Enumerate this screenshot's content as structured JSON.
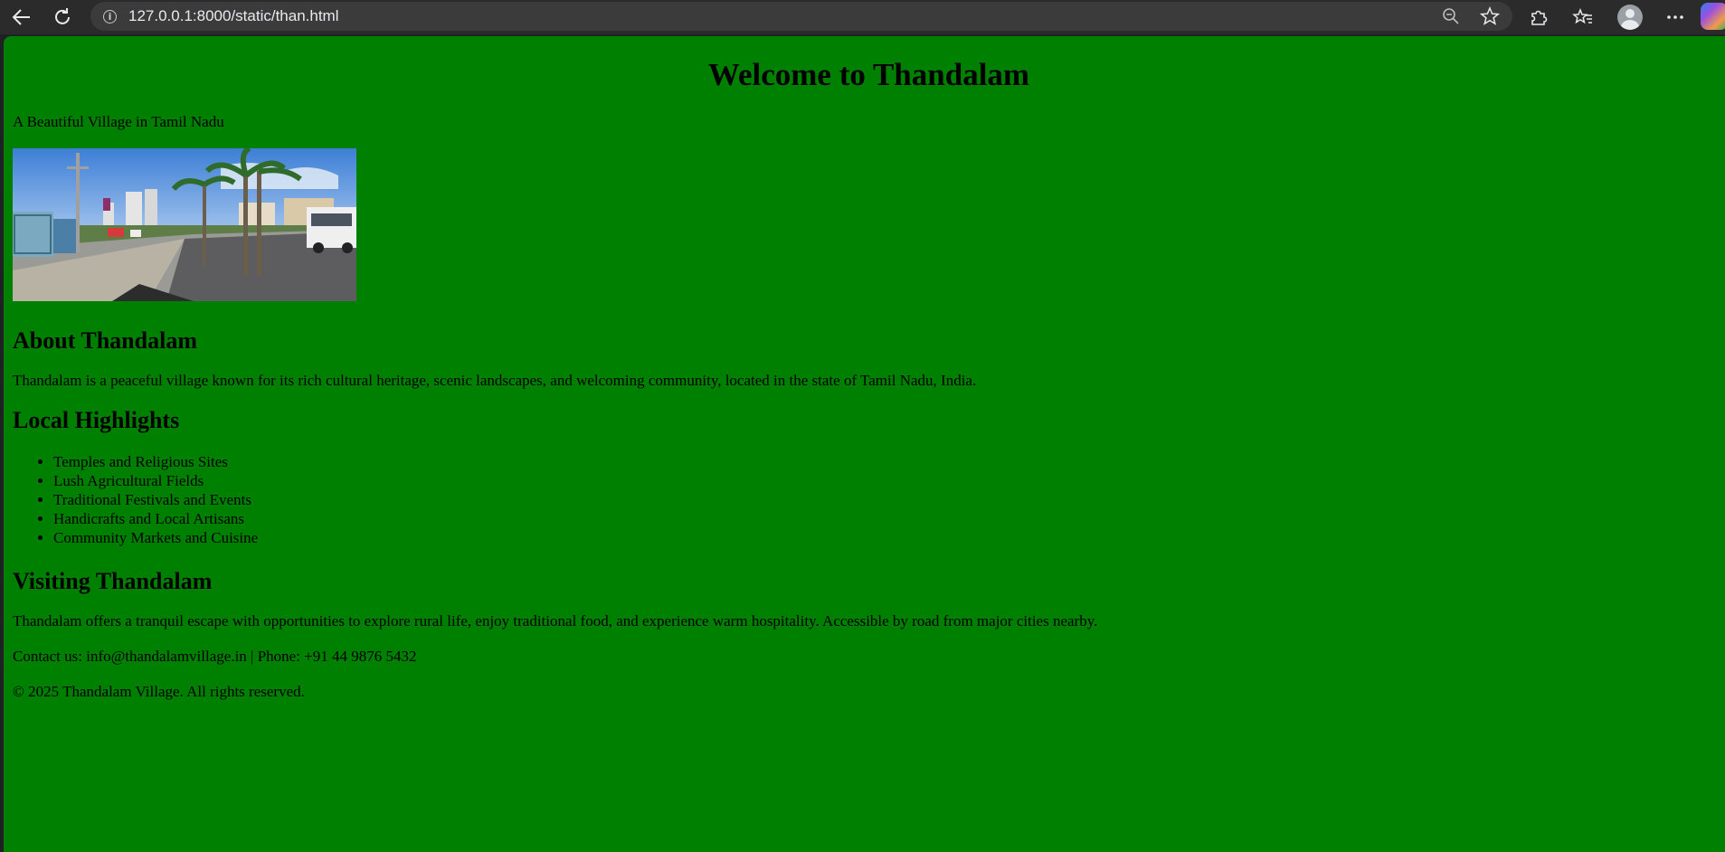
{
  "browser": {
    "url": "127.0.0.1:8000/static/than.html"
  },
  "page": {
    "title": "Welcome to Thandalam",
    "tagline": "A Beautiful Village in Tamil Nadu",
    "about": {
      "heading": "About Thandalam",
      "text": "Thandalam is a peaceful village known for its rich cultural heritage, scenic landscapes, and welcoming community, located in the state of Tamil Nadu, India."
    },
    "highlights": {
      "heading": "Local Highlights",
      "items": [
        "Temples and Religious Sites",
        "Lush Agricultural Fields",
        "Traditional Festivals and Events",
        "Handicrafts and Local Artisans",
        "Community Markets and Cuisine"
      ]
    },
    "visiting": {
      "heading": "Visiting Thandalam",
      "text": "Thandalam offers a tranquil escape with opportunities to explore rural life, enjoy traditional food, and experience warm hospitality. Accessible by road from major cities nearby."
    },
    "contact": "Contact us: info@thandalamvillage.in | Phone: +91 44 9876 5432",
    "footer": "© 2025 Thandalam Village. All rights reserved.",
    "background_color": "#008000"
  }
}
